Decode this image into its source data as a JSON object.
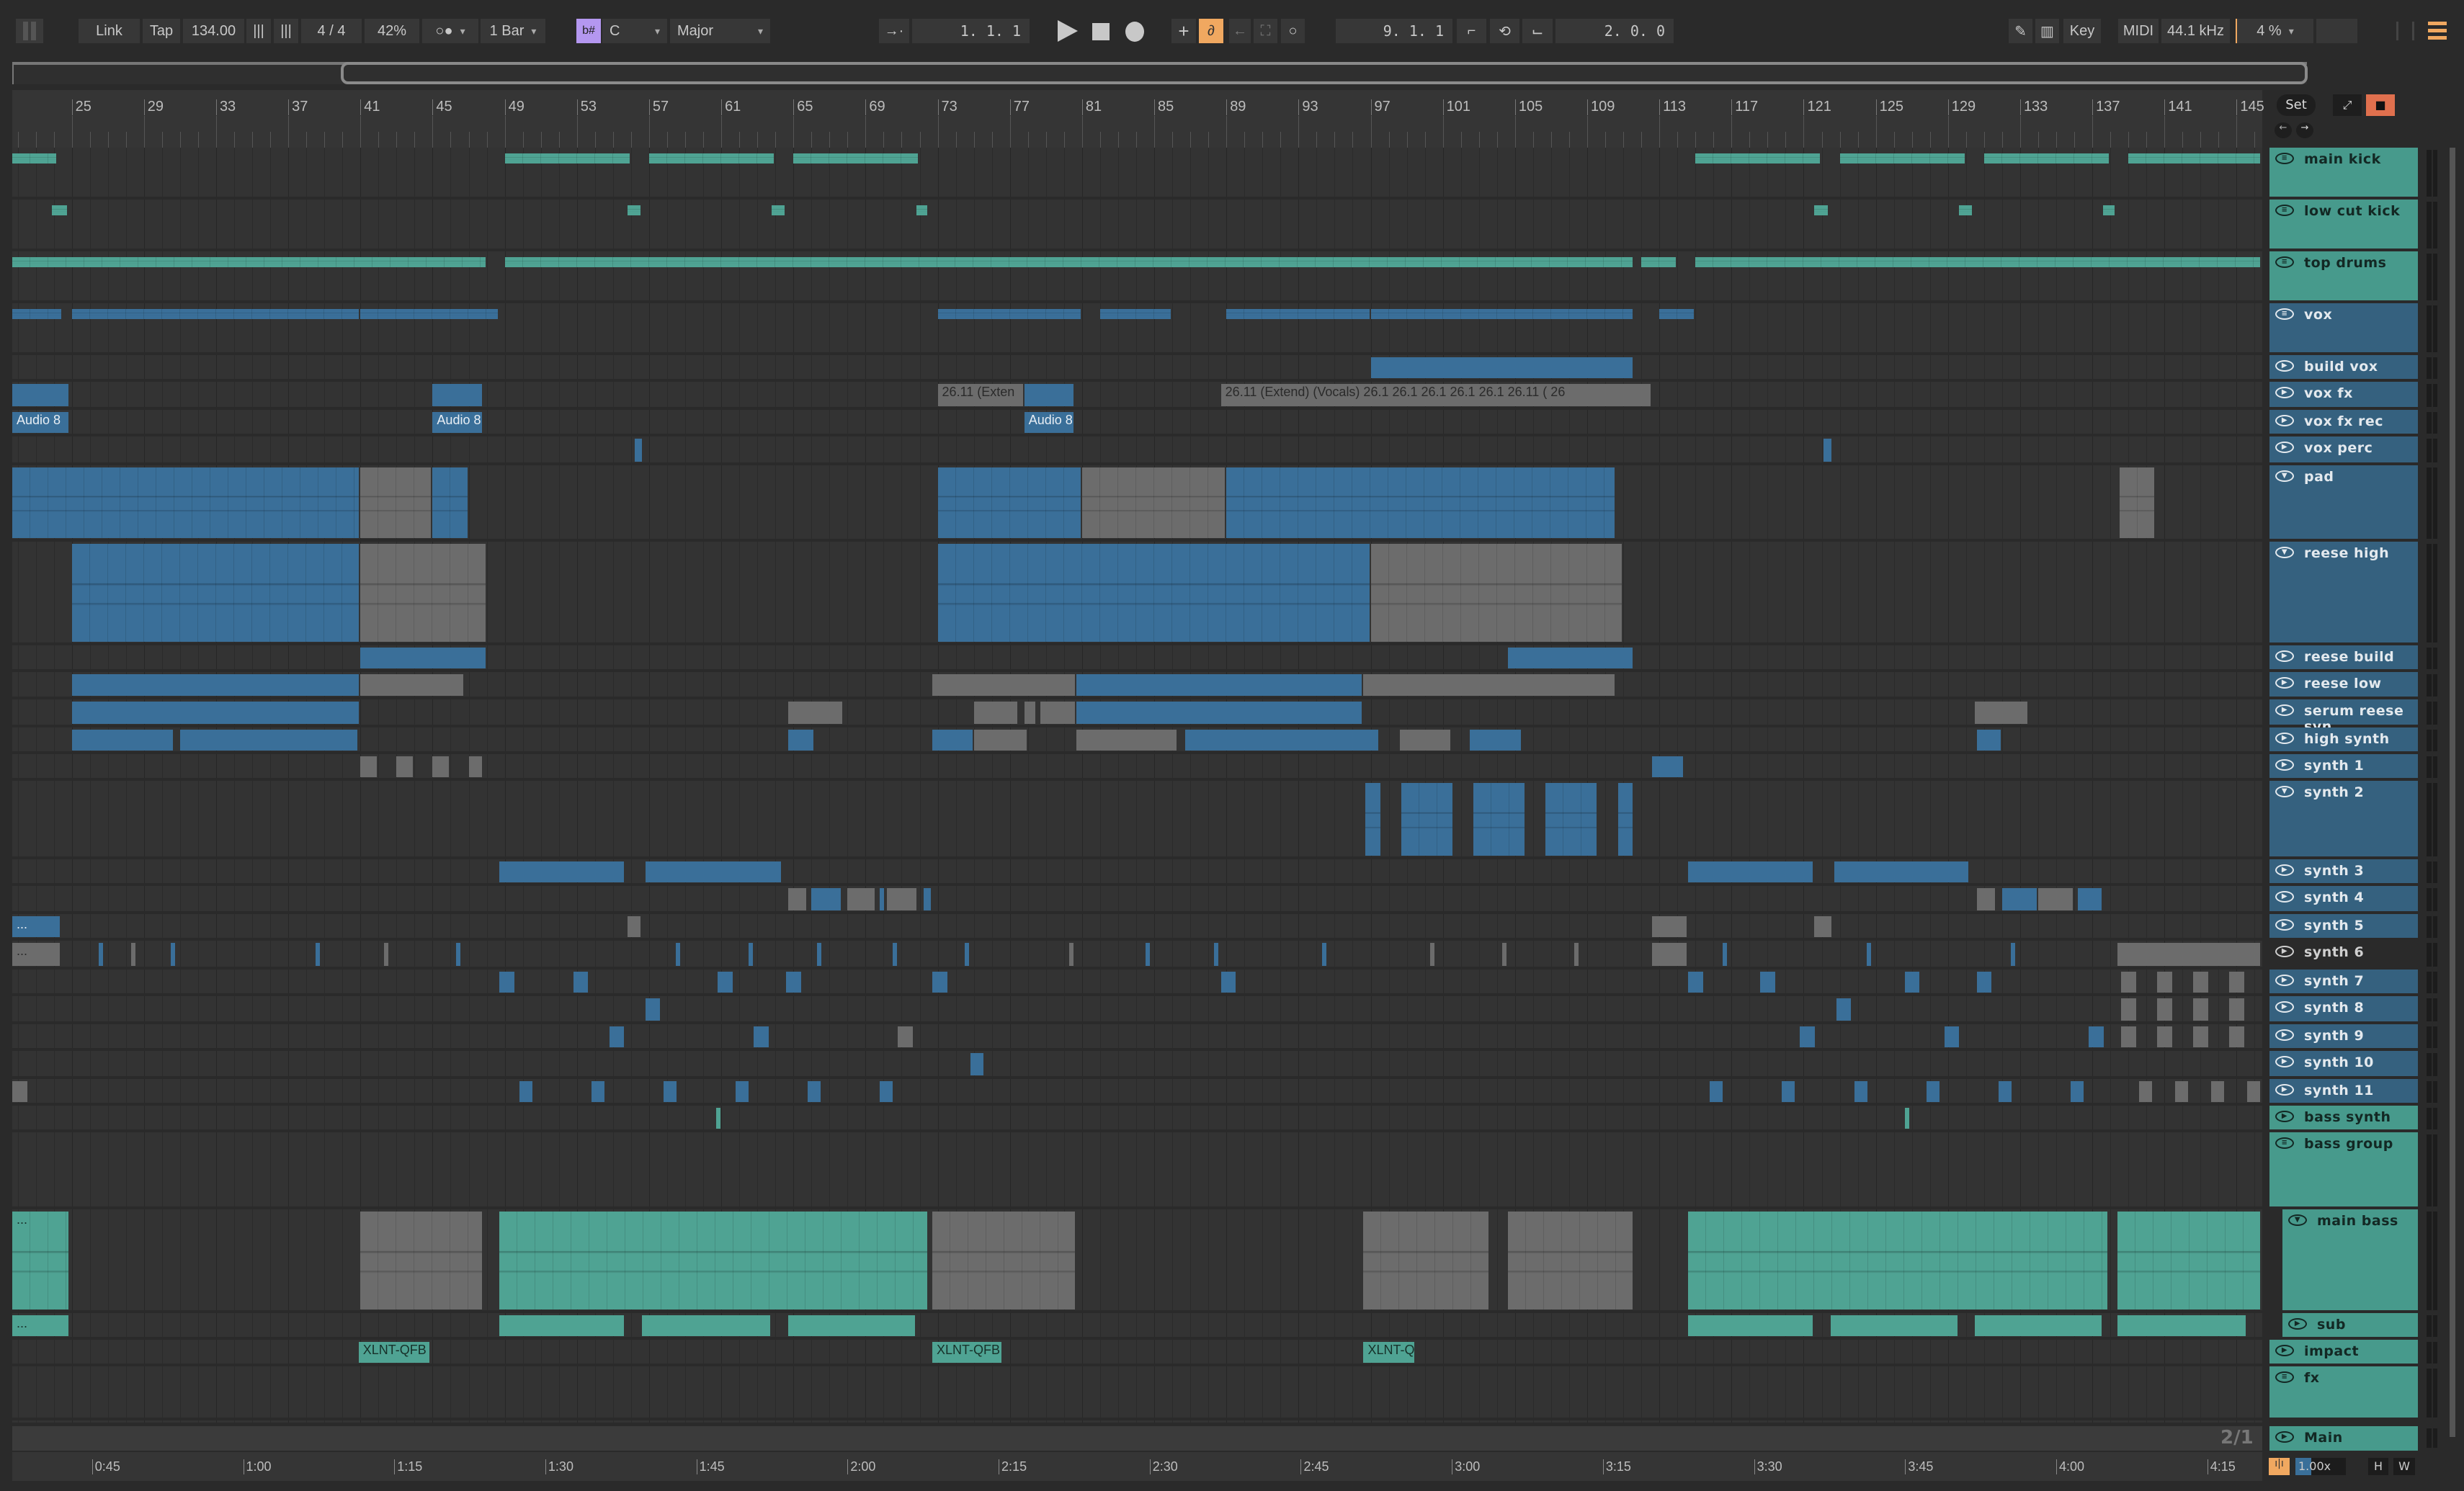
{
  "toolbar": {
    "link": "Link",
    "tap": "Tap",
    "tempo": "134.00",
    "time_signature": "4 / 4",
    "groove": "42%",
    "metro_icon": "metronome-icon",
    "quantize": "1 Bar",
    "scale_icon": "b#",
    "key": "C",
    "scale": "Major",
    "position": "1.  1.  1",
    "loop_start": "9.  1.  1",
    "loop_length": "2.  0.  0",
    "key_map": "Key",
    "midi_map": "MIDI",
    "sample_rate": "44.1 kHz",
    "cpu": "4 %"
  },
  "colors": {
    "teal": "#4fa393",
    "blue": "#3a6f99",
    "gray": "#6c6c6c",
    "orange": "#f0a860",
    "purple": "#b497f0",
    "lock": "#e0704e"
  },
  "ruler": {
    "bars": [
      25,
      29,
      33,
      37,
      41,
      45,
      49,
      53,
      57,
      61,
      65,
      69,
      73,
      77,
      81,
      85,
      89,
      93,
      97,
      101,
      105,
      109,
      113,
      117,
      121,
      125,
      129,
      133,
      137,
      141,
      145
    ],
    "set_label": "Set"
  },
  "time_ruler": {
    "labels": [
      "0:45",
      "1:00",
      "1:15",
      "1:30",
      "1:45",
      "2:00",
      "2:15",
      "2:30",
      "2:45",
      "3:00",
      "3:15",
      "3:30",
      "3:45",
      "4:00",
      "4:15"
    ],
    "seconds": [
      45,
      60,
      75,
      90,
      105,
      120,
      135,
      150,
      165,
      180,
      195,
      210,
      225,
      240,
      255
    ]
  },
  "footer": {
    "grid": "2/1",
    "zoom": "1.00x",
    "h": "H",
    "w": "W"
  },
  "tracks": [
    {
      "name": "main kick",
      "color": "t",
      "icon": "group",
      "clips": [
        [
          21.7,
          24.2,
          "t"
        ],
        [
          49,
          56,
          "t"
        ],
        [
          57,
          64,
          "t"
        ],
        [
          65,
          72,
          "t"
        ],
        [
          115,
          122,
          "t"
        ],
        [
          123,
          130,
          "t"
        ],
        [
          131,
          138,
          "t"
        ],
        [
          139,
          146.4,
          "t"
        ]
      ]
    },
    {
      "name": "low cut kick",
      "color": "t",
      "icon": "group",
      "clips": [
        [
          23.9,
          24.8,
          "t"
        ],
        [
          55.8,
          56.6,
          "t"
        ],
        [
          63.8,
          64.6,
          "t"
        ],
        [
          71.8,
          72.5,
          "t"
        ],
        [
          121.6,
          122.4,
          "t"
        ],
        [
          129.6,
          130.4,
          "t"
        ],
        [
          137.6,
          138.3,
          "t"
        ]
      ]
    },
    {
      "name": "top drums",
      "color": "t",
      "icon": "group",
      "clips": [
        [
          21.7,
          48,
          "t"
        ],
        [
          49,
          111.6,
          "t"
        ],
        [
          112,
          114,
          "t"
        ],
        [
          115,
          146.4,
          "t"
        ]
      ]
    },
    {
      "name": "vox",
      "color": "b",
      "icon": "group",
      "clips": [
        [
          21.7,
          24.5,
          "b"
        ],
        [
          25,
          41,
          "b"
        ],
        [
          41,
          48.7,
          "b"
        ],
        [
          73,
          81,
          "b"
        ],
        [
          82,
          86,
          "b"
        ],
        [
          89,
          97,
          "b"
        ],
        [
          97,
          111.6,
          "b"
        ],
        [
          113,
          115,
          "b"
        ]
      ]
    },
    {
      "name": "build vox",
      "color": "b",
      "icon": "play",
      "clips": [
        [
          97,
          111.6,
          "b"
        ]
      ]
    },
    {
      "name": "vox fx",
      "color": "b",
      "icon": "play",
      "clips": [
        [
          21.7,
          24.9,
          "b"
        ],
        [
          45,
          47.8,
          "b"
        ],
        [
          73,
          77.8,
          "g",
          "26.11 (Exten"
        ],
        [
          77.8,
          80.6,
          "b"
        ],
        [
          88.7,
          112.6,
          "g",
          "26.11 (Extend) (Vocals)   26.1  26.1  26.1  26.1  26.1  26.11 (  26"
        ]
      ]
    },
    {
      "name": "vox fx rec",
      "color": "b",
      "icon": "play",
      "clips": [
        [
          21.7,
          24.9,
          "b",
          "Audio 8"
        ],
        [
          45,
          47.8,
          "b",
          "Audio 8"
        ],
        [
          77.8,
          80.6,
          "b",
          "Audio 8"
        ]
      ]
    },
    {
      "name": "vox perc",
      "color": "b",
      "icon": "play",
      "clips": [
        [
          56.2,
          56.7,
          "b"
        ],
        [
          122.1,
          122.6,
          "b"
        ]
      ]
    },
    {
      "name": "pad",
      "color": "b",
      "icon": "fold",
      "clips": [
        [
          21.7,
          41,
          "b"
        ],
        [
          41,
          45,
          "g"
        ],
        [
          45,
          47,
          "b"
        ],
        [
          73,
          81,
          "b"
        ],
        [
          81,
          89,
          "g"
        ],
        [
          89,
          110.6,
          "b"
        ],
        [
          138.5,
          140.5,
          "g"
        ]
      ]
    },
    {
      "name": "reese high",
      "color": "b",
      "icon": "fold",
      "clips": [
        [
          25,
          41,
          "b"
        ],
        [
          41,
          48,
          "g"
        ],
        [
          73,
          97,
          "b"
        ],
        [
          97,
          111,
          "g"
        ]
      ]
    },
    {
      "name": "reese build",
      "color": "b",
      "icon": "play",
      "clips": [
        [
          41,
          48,
          "b"
        ],
        [
          104.6,
          111.6,
          "b"
        ]
      ]
    },
    {
      "name": "reese low",
      "color": "b",
      "icon": "play",
      "clips": [
        [
          25,
          41,
          "b"
        ],
        [
          41,
          46.8,
          "g"
        ],
        [
          72.7,
          80.7,
          "g"
        ],
        [
          80.7,
          96.6,
          "b"
        ],
        [
          96.6,
          110.6,
          "g"
        ]
      ]
    },
    {
      "name": "serum reese syn",
      "color": "b",
      "icon": "play",
      "clips": [
        [
          25,
          41,
          "b"
        ],
        [
          64.7,
          67.8,
          "g"
        ],
        [
          75,
          77.5,
          "g"
        ],
        [
          77.8,
          78.5,
          "g"
        ],
        [
          78.7,
          80.7,
          "g"
        ],
        [
          80.7,
          96.6,
          "b"
        ],
        [
          130.5,
          133.5,
          "g"
        ]
      ]
    },
    {
      "name": "high synth",
      "color": "b",
      "icon": "play",
      "clips": [
        [
          25,
          30.7,
          "b"
        ],
        [
          31,
          40.9,
          "b"
        ],
        [
          64.7,
          66.2,
          "b"
        ],
        [
          72.7,
          75,
          "b"
        ],
        [
          75,
          78,
          "g"
        ],
        [
          80.7,
          86.3,
          "g"
        ],
        [
          86.7,
          97.5,
          "b"
        ],
        [
          98.6,
          101.5,
          "g"
        ],
        [
          102.5,
          105.4,
          "b"
        ],
        [
          130.6,
          132,
          "b"
        ]
      ]
    },
    {
      "name": "synth 1",
      "color": "b",
      "icon": "play",
      "clips": [
        [
          41,
          42,
          "g"
        ],
        [
          43,
          44,
          "g"
        ],
        [
          45,
          46,
          "g"
        ],
        [
          47,
          47.8,
          "g"
        ],
        [
          112.6,
          114.4,
          "b"
        ]
      ]
    },
    {
      "name": "synth 2",
      "color": "b",
      "icon": "fold",
      "clips": [
        [
          96.7,
          97.6,
          "b"
        ],
        [
          98.7,
          101.6,
          "b"
        ],
        [
          102.7,
          105.6,
          "b"
        ],
        [
          106.7,
          109.6,
          "b"
        ],
        [
          110.7,
          111.6,
          "b"
        ]
      ]
    },
    {
      "name": "synth 3",
      "color": "b",
      "icon": "play",
      "clips": [
        [
          48.7,
          55.7,
          "b"
        ],
        [
          56.8,
          64.4,
          "b"
        ],
        [
          114.6,
          121.6,
          "b"
        ],
        [
          122.7,
          130.2,
          "b"
        ]
      ]
    },
    {
      "name": "synth 4",
      "color": "b",
      "icon": "play",
      "clips": [
        [
          64.7,
          65.8,
          "g"
        ],
        [
          66,
          67.7,
          "b"
        ],
        [
          68,
          69.6,
          "g"
        ],
        [
          69.8,
          70,
          "b"
        ],
        [
          70.2,
          71.9,
          "g"
        ],
        [
          72.2,
          72.7,
          "b"
        ],
        [
          130.6,
          131.7,
          "g"
        ],
        [
          132,
          134,
          "b"
        ],
        [
          134,
          136,
          "g"
        ],
        [
          136.2,
          137.6,
          "b"
        ]
      ]
    },
    {
      "name": "synth 5",
      "color": "b",
      "icon": "play",
      "clips": [
        [
          21.7,
          24.4,
          "b",
          "..."
        ],
        [
          55.8,
          56.6,
          "g"
        ],
        [
          112.6,
          114.6,
          "g"
        ],
        [
          121.6,
          122.6,
          "g"
        ]
      ]
    },
    {
      "name": "synth 6",
      "color": "g",
      "icon": "play",
      "clips": [
        [
          21.7,
          24.4,
          "g",
          "..."
        ],
        [
          26.5,
          26.7,
          "b"
        ],
        [
          28.3,
          28.5,
          "g"
        ],
        [
          30.5,
          30.7,
          "b"
        ],
        [
          38.5,
          38.7,
          "b"
        ],
        [
          42.3,
          42.5,
          "g"
        ],
        [
          46.3,
          46.5,
          "b"
        ],
        [
          58.5,
          58.7,
          "b"
        ],
        [
          62.5,
          62.7,
          "b"
        ],
        [
          66.3,
          66.5,
          "b"
        ],
        [
          70.5,
          70.7,
          "b"
        ],
        [
          74.5,
          74.7,
          "b"
        ],
        [
          80.3,
          80.5,
          "g"
        ],
        [
          84.5,
          84.7,
          "b"
        ],
        [
          88.3,
          88.5,
          "b"
        ],
        [
          94.3,
          94.5,
          "b"
        ],
        [
          100.3,
          100.5,
          "g"
        ],
        [
          104.3,
          104.5,
          "g"
        ],
        [
          108.3,
          108.5,
          "g"
        ],
        [
          112.6,
          114.6,
          "g"
        ],
        [
          116.5,
          116.7,
          "b"
        ],
        [
          124.5,
          124.7,
          "b"
        ],
        [
          132.5,
          132.7,
          "b"
        ],
        [
          138.4,
          146.4,
          "g"
        ]
      ]
    },
    {
      "name": "synth 7",
      "color": "b",
      "icon": "play",
      "clips": [
        [
          48.7,
          49.6,
          "b"
        ],
        [
          52.8,
          53.7,
          "b"
        ],
        [
          60.8,
          61.7,
          "b"
        ],
        [
          64.6,
          65.5,
          "b"
        ],
        [
          72.7,
          73.6,
          "b"
        ],
        [
          88.7,
          89.6,
          "b"
        ],
        [
          114.6,
          115.5,
          "b"
        ],
        [
          118.6,
          119.5,
          "b"
        ],
        [
          126.6,
          127.5,
          "b"
        ],
        [
          130.6,
          131.5,
          "b"
        ],
        [
          138.6,
          139.5,
          "g"
        ],
        [
          140.6,
          141.5,
          "g"
        ],
        [
          142.6,
          143.5,
          "g"
        ],
        [
          144.6,
          145.5,
          "g"
        ]
      ]
    },
    {
      "name": "synth 8",
      "color": "b",
      "icon": "play",
      "clips": [
        [
          56.8,
          57.7,
          "b"
        ],
        [
          122.8,
          123.7,
          "b"
        ],
        [
          138.6,
          139.5,
          "g"
        ],
        [
          140.6,
          141.5,
          "g"
        ],
        [
          142.6,
          143.5,
          "g"
        ],
        [
          144.6,
          145.5,
          "g"
        ]
      ]
    },
    {
      "name": "synth 9",
      "color": "b",
      "icon": "play",
      "clips": [
        [
          54.8,
          55.7,
          "b"
        ],
        [
          62.8,
          63.7,
          "b"
        ],
        [
          70.8,
          71.7,
          "g"
        ],
        [
          120.8,
          121.7,
          "b"
        ],
        [
          128.8,
          129.7,
          "b"
        ],
        [
          136.8,
          137.7,
          "b"
        ],
        [
          138.6,
          139.5,
          "g"
        ],
        [
          140.6,
          141.5,
          "g"
        ],
        [
          142.6,
          143.5,
          "g"
        ],
        [
          144.6,
          145.5,
          "g"
        ]
      ]
    },
    {
      "name": "synth 10",
      "color": "b",
      "icon": "play",
      "clips": [
        [
          74.8,
          75.6,
          "b"
        ]
      ]
    },
    {
      "name": "synth 11",
      "color": "b",
      "icon": "play",
      "clips": [
        [
          21.7,
          22.6,
          "g"
        ],
        [
          49.8,
          50.6,
          "b"
        ],
        [
          53.8,
          54.6,
          "b"
        ],
        [
          57.8,
          58.6,
          "b"
        ],
        [
          61.8,
          62.6,
          "b"
        ],
        [
          65.8,
          66.6,
          "b"
        ],
        [
          69.8,
          70.6,
          "b"
        ],
        [
          115.8,
          116.6,
          "b"
        ],
        [
          119.8,
          120.6,
          "b"
        ],
        [
          123.8,
          124.6,
          "b"
        ],
        [
          127.8,
          128.6,
          "b"
        ],
        [
          131.8,
          132.6,
          "b"
        ],
        [
          135.8,
          136.6,
          "b"
        ],
        [
          139.6,
          140.4,
          "g"
        ],
        [
          141.6,
          142.4,
          "g"
        ],
        [
          143.6,
          144.4,
          "g"
        ],
        [
          145.6,
          146.4,
          "g"
        ]
      ]
    },
    {
      "name": "bass synth",
      "color": "t",
      "icon": "play",
      "clips": [
        [
          60.7,
          60.9,
          "t"
        ],
        [
          126.6,
          126.8,
          "t"
        ]
      ]
    },
    {
      "name": "bass group",
      "color": "t",
      "icon": "group",
      "clips": []
    },
    {
      "name": "main bass",
      "color": "t",
      "icon": "fold",
      "indent": true,
      "clips": [
        [
          21.7,
          24.9,
          "t",
          "..."
        ],
        [
          41,
          47.8,
          "g"
        ],
        [
          48.7,
          72.5,
          "t"
        ],
        [
          72.7,
          80.7,
          "g"
        ],
        [
          96.6,
          103.6,
          "g"
        ],
        [
          104.6,
          111.6,
          "g"
        ],
        [
          114.6,
          137.9,
          "t"
        ],
        [
          138.4,
          146.4,
          "t"
        ]
      ]
    },
    {
      "name": "sub",
      "color": "t",
      "icon": "play",
      "indent": true,
      "clips": [
        [
          21.7,
          24.9,
          "t",
          "..."
        ],
        [
          48.7,
          55.7,
          "t"
        ],
        [
          56.6,
          63.8,
          "t"
        ],
        [
          64.7,
          71.8,
          "t"
        ],
        [
          114.6,
          121.6,
          "t"
        ],
        [
          122.5,
          129.6,
          "t"
        ],
        [
          130.5,
          137.6,
          "t"
        ],
        [
          138.4,
          145.6,
          "t"
        ]
      ]
    },
    {
      "name": "impact",
      "color": "t",
      "icon": "play",
      "clips": [
        [
          40.9,
          44.9,
          "t",
          "XLNT-QFB"
        ],
        [
          72.7,
          76.6,
          "t",
          "XLNT-QFB"
        ],
        [
          96.6,
          99.5,
          "t",
          "XLNT-Q"
        ]
      ]
    },
    {
      "name": "fx",
      "color": "t",
      "icon": "group",
      "clips": []
    }
  ],
  "master": {
    "name": "Main",
    "color": "t",
    "icon": "play"
  }
}
